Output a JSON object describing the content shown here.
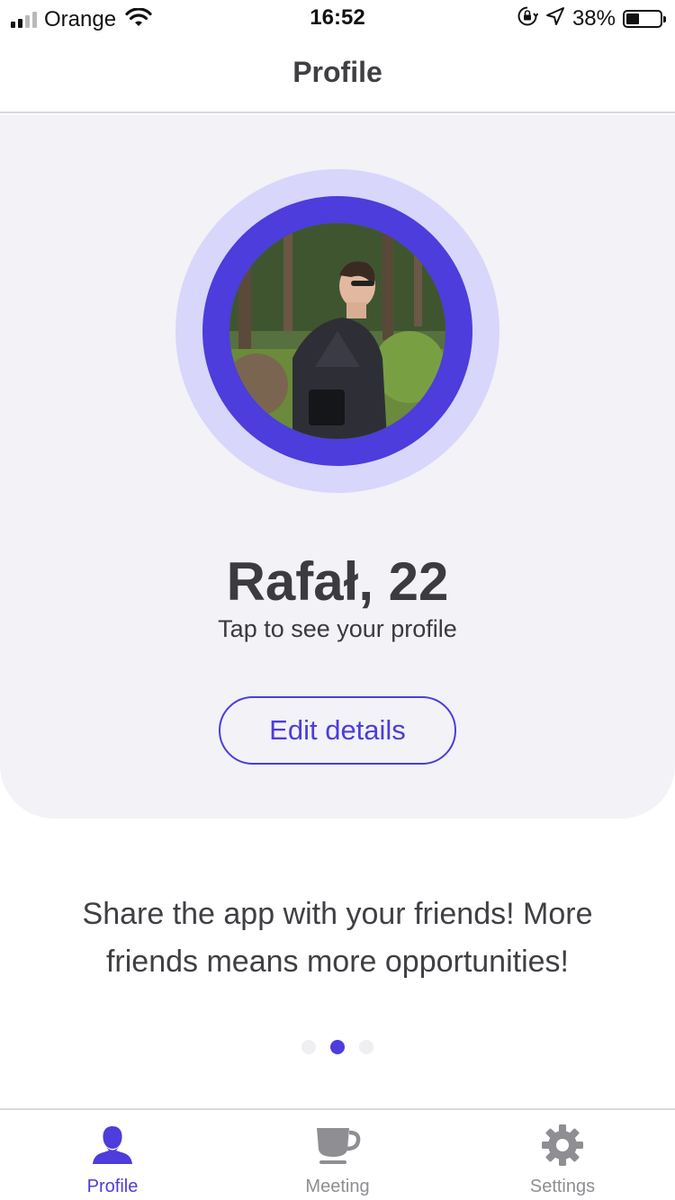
{
  "status_bar": {
    "carrier": "Orange",
    "time": "16:52",
    "battery_percent": "38%",
    "battery_level": 0.38,
    "signal_bars": 2,
    "signal_total": 4,
    "icons": [
      "signal-icon",
      "wifi-icon",
      "orientation-lock-icon",
      "location-icon",
      "battery-icon"
    ]
  },
  "nav": {
    "title": "Profile"
  },
  "profile": {
    "name": "Rafał, 22",
    "subtitle": "Tap to see your profile",
    "edit_button_label": "Edit details",
    "avatar_icon": "user-photo"
  },
  "share": {
    "text": "Share the app with your friends! More friends means more opportunities!"
  },
  "pager": {
    "count": 3,
    "active_index": 1
  },
  "tabs": [
    {
      "label": "Profile",
      "icon": "person-icon",
      "active": true
    },
    {
      "label": "Meeting",
      "icon": "cup-icon",
      "active": false
    },
    {
      "label": "Settings",
      "icon": "gear-icon",
      "active": false
    }
  ],
  "colors": {
    "accent": "#4c3ddc",
    "accent_light": "#d8d6fa",
    "card_background": "#f2f2f7",
    "inactive": "#8e8e93"
  }
}
